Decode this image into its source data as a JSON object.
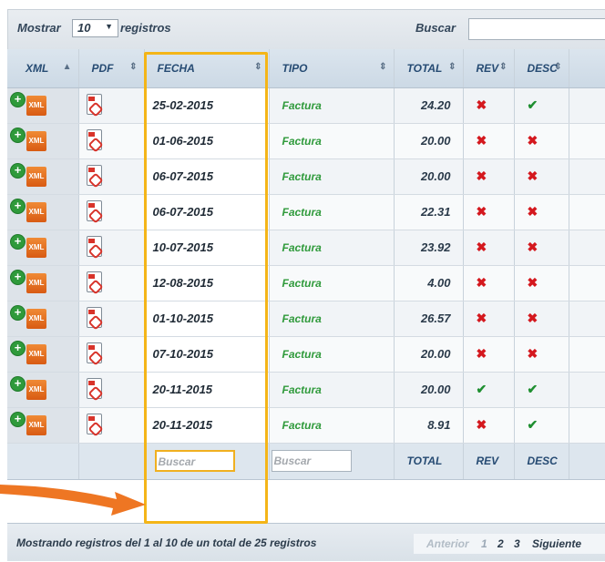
{
  "length_control": {
    "label_before": "Mostrar",
    "selected": "10",
    "label_after": "registros"
  },
  "search": {
    "label": "Buscar",
    "value": ""
  },
  "columns": {
    "xml": "XML",
    "pdf": "PDF",
    "fecha": "FECHA",
    "tipo": "TIPO",
    "total": "TOTAL",
    "rev": "REV",
    "desc": "DESC"
  },
  "rows": [
    {
      "fecha": "25-02-2015",
      "tipo": "Factura",
      "total": "24.20",
      "rev": "x",
      "desc": "check"
    },
    {
      "fecha": "01-06-2015",
      "tipo": "Factura",
      "total": "20.00",
      "rev": "x",
      "desc": "x"
    },
    {
      "fecha": "06-07-2015",
      "tipo": "Factura",
      "total": "20.00",
      "rev": "x",
      "desc": "x"
    },
    {
      "fecha": "06-07-2015",
      "tipo": "Factura",
      "total": "22.31",
      "rev": "x",
      "desc": "x"
    },
    {
      "fecha": "10-07-2015",
      "tipo": "Factura",
      "total": "23.92",
      "rev": "x",
      "desc": "x"
    },
    {
      "fecha": "12-08-2015",
      "tipo": "Factura",
      "total": "4.00",
      "rev": "x",
      "desc": "x"
    },
    {
      "fecha": "01-10-2015",
      "tipo": "Factura",
      "total": "26.57",
      "rev": "x",
      "desc": "x"
    },
    {
      "fecha": "07-10-2015",
      "tipo": "Factura",
      "total": "20.00",
      "rev": "x",
      "desc": "x"
    },
    {
      "fecha": "20-11-2015",
      "tipo": "Factura",
      "total": "20.00",
      "rev": "check",
      "desc": "check"
    },
    {
      "fecha": "20-11-2015",
      "tipo": "Factura",
      "total": "8.91",
      "rev": "x",
      "desc": "check"
    }
  ],
  "footer_filters": {
    "fecha_placeholder": "Buscar",
    "tipo_placeholder": "Buscar",
    "total": "TOTAL",
    "rev": "REV",
    "desc": "DESC"
  },
  "status_info": "Mostrando registros del 1 al 10 de un total de 25 registros",
  "pagination": {
    "previous": "Anterior",
    "pages": [
      "1",
      "2",
      "3"
    ],
    "next": "Siguiente"
  },
  "icons": {
    "expand": "plus-circle-icon",
    "xml": "xml-file-icon",
    "pdf": "pdf-file-icon",
    "no": "cross-icon",
    "yes": "check-icon"
  },
  "colors": {
    "highlight": "#f4b518",
    "arrow": "#ee7623",
    "tipo_text": "#2f9a3b",
    "cross": "#d4181e",
    "check": "#1f8f31"
  }
}
